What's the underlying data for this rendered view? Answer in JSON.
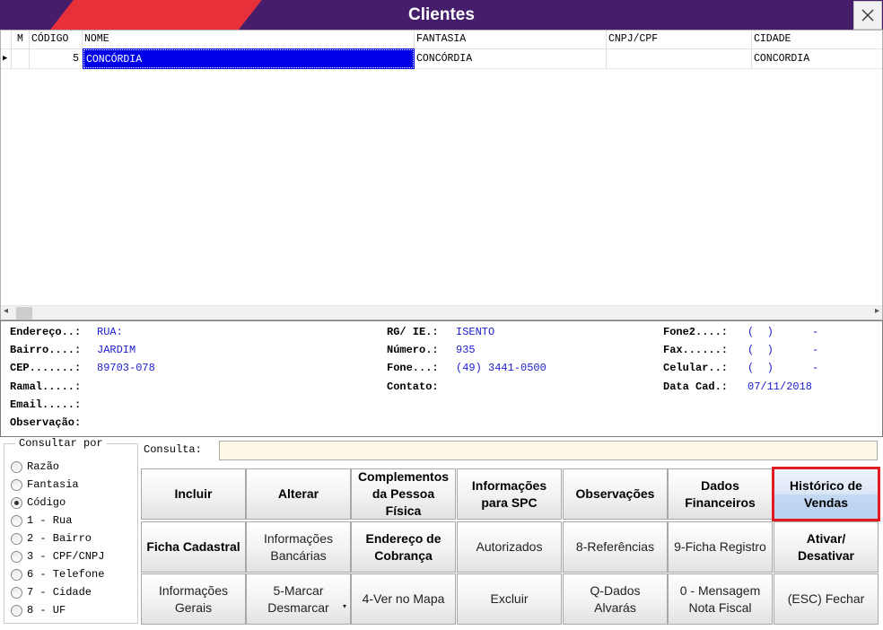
{
  "window": {
    "title": "Clientes",
    "close_glyph": "✕"
  },
  "grid": {
    "columns": [
      "M",
      "CÓDIGO",
      "NOME",
      "FANTASIA",
      "CNPJ/CPF",
      "CIDADE"
    ],
    "rows": [
      {
        "indicator": "▶",
        "m": "",
        "codigo": "5",
        "nome": "CONCÓRDIA",
        "fantasia": "CONCÓRDIA",
        "cnpj": "",
        "cidade": "CONCORDIA"
      }
    ],
    "scroll_left": "◂",
    "scroll_right": "▸"
  },
  "details": {
    "endereco_label": "Endereço..:",
    "endereco": "RUA:",
    "bairro_label": "Bairro....:",
    "bairro": "JARDIM",
    "cep_label": "CEP.......:",
    "cep": "89703-078",
    "ramal_label": "Ramal.....:",
    "ramal": "",
    "email_label": "Email.....:",
    "email": "",
    "obs_label": "Observação:",
    "obs": "",
    "rg_label": "RG/ IE.:",
    "rg": "ISENTO",
    "numero_label": "Número.:",
    "numero": "935",
    "fone_label": "Fone...:",
    "fone": "(49) 3441-0500",
    "contato_label": "Contato:",
    "contato": "",
    "fone2_label": "Fone2....:",
    "fone2": "(  )      -",
    "fax_label": "Fax......:",
    "fax": "(  )      -",
    "celular_label": "Celular..:",
    "celular": "(  )      -",
    "datacad_label": "Data Cad.:",
    "datacad": "07/11/2018"
  },
  "consultar": {
    "title": "Consultar por",
    "options": [
      {
        "label": "Razão",
        "selected": false
      },
      {
        "label": "Fantasia",
        "selected": false
      },
      {
        "label": "Código",
        "selected": true
      },
      {
        "label": "1 - Rua",
        "selected": false
      },
      {
        "label": "2 - Bairro",
        "selected": false
      },
      {
        "label": "3 - CPF/CNPJ",
        "selected": false
      },
      {
        "label": "6 - Telefone",
        "selected": false
      },
      {
        "label": "7 - Cidade",
        "selected": false
      },
      {
        "label": "8 - UF",
        "selected": false
      }
    ]
  },
  "consulta": {
    "label": "Consulta:",
    "value": ""
  },
  "buttons": {
    "incluir": "Incluir",
    "alterar": "Alterar",
    "complementos": "Complementos\nda Pessoa\nFísica",
    "info_spc": "Informações\npara SPC",
    "observacoes": "Observações",
    "dados_financeiros": "Dados\nFinanceiros",
    "historico_vendas": "Histórico de\nVendas",
    "ficha_cadastral": "Ficha Cadastral",
    "info_bancarias": "Informações\nBancárias",
    "endereco_cobranca": "Endereço de\nCobrança",
    "autorizados": "Autorizados",
    "referencias": "8-Referências",
    "ficha_registro": "9-Ficha Registro",
    "ativar_desativar": "Ativar/\nDesativar",
    "info_gerais": "Informações\nGerais",
    "marcar_desmarcar": "5-Marcar\nDesmarcar",
    "ver_mapa": "4-Ver no Mapa",
    "excluir": "Excluir",
    "dados_alvaras": "Q-Dados\nAlvarás",
    "mensagem_nf": "0 - Mensagem\nNota Fiscal",
    "fechar": "(ESC) Fechar",
    "dropdown_glyph": "▾"
  },
  "colors": {
    "titlebar": "#451d6a",
    "accent": "#e8303a",
    "selection": "#0000e8",
    "value_text": "#1b1bd0",
    "highlight_border": "#e11b22"
  }
}
